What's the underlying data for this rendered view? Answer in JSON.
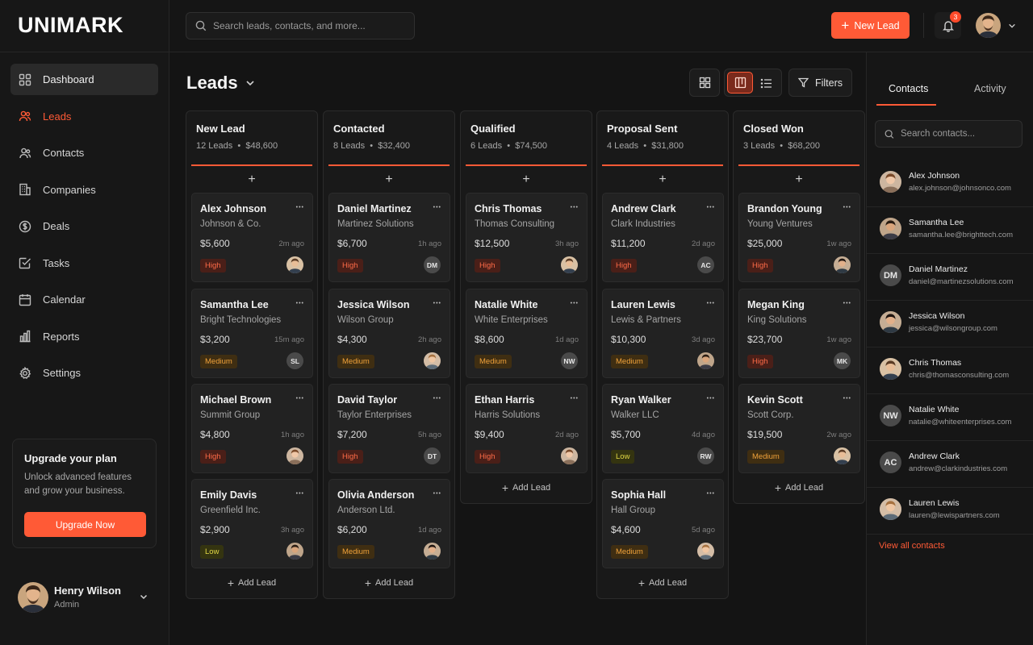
{
  "app": {
    "logo": "UNIMARK"
  },
  "topbar": {
    "search_placeholder": "Search leads, contacts, and more...",
    "new_lead_label": "New Lead",
    "notification_count": "3"
  },
  "sidebar": {
    "items": [
      {
        "label": "Dashboard",
        "icon": "dashboard-icon"
      },
      {
        "label": "Leads",
        "icon": "users-icon"
      },
      {
        "label": "Contacts",
        "icon": "contacts-icon"
      },
      {
        "label": "Companies",
        "icon": "building-icon"
      },
      {
        "label": "Deals",
        "icon": "dollar-icon"
      },
      {
        "label": "Tasks",
        "icon": "task-check-icon"
      },
      {
        "label": "Calendar",
        "icon": "calendar-icon"
      },
      {
        "label": "Reports",
        "icon": "bar-chart-icon"
      },
      {
        "label": "Settings",
        "icon": "gear-icon"
      }
    ],
    "upgrade": {
      "title": "Upgrade your plan",
      "description": "Unlock advanced features and grow your business.",
      "button": "Upgrade Now"
    },
    "user": {
      "name": "Henry Wilson",
      "role": "Admin"
    }
  },
  "main": {
    "title": "Leads",
    "filters_label": "Filters",
    "add_lead_label": "Add Lead",
    "columns": [
      {
        "title": "New Lead",
        "count": "12 Leads",
        "total": "$48,600",
        "cards": [
          {
            "name": "Alex Johnson",
            "company": "Johnson & Co.",
            "value": "$5,600",
            "time": "2m ago",
            "priority": "High",
            "avatar": "photo"
          },
          {
            "name": "Samantha Lee",
            "company": "Bright Technologies",
            "value": "$3,200",
            "time": "15m ago",
            "priority": "Medium",
            "avatar": "SL"
          },
          {
            "name": "Michael Brown",
            "company": "Summit Group",
            "value": "$4,800",
            "time": "1h ago",
            "priority": "High",
            "avatar": "photo"
          },
          {
            "name": "Emily Davis",
            "company": "Greenfield Inc.",
            "value": "$2,900",
            "time": "3h ago",
            "priority": "Low",
            "avatar": "photo"
          }
        ]
      },
      {
        "title": "Contacted",
        "count": "8 Leads",
        "total": "$32,400",
        "cards": [
          {
            "name": "Daniel Martinez",
            "company": "Martinez Solutions",
            "value": "$6,700",
            "time": "1h ago",
            "priority": "High",
            "avatar": "DM"
          },
          {
            "name": "Jessica Wilson",
            "company": "Wilson Group",
            "value": "$4,300",
            "time": "2h ago",
            "priority": "Medium",
            "avatar": "photo"
          },
          {
            "name": "David Taylor",
            "company": "Taylor Enterprises",
            "value": "$7,200",
            "time": "5h ago",
            "priority": "High",
            "avatar": "DT"
          },
          {
            "name": "Olivia Anderson",
            "company": "Anderson Ltd.",
            "value": "$6,200",
            "time": "1d ago",
            "priority": "Medium",
            "avatar": "photo"
          }
        ]
      },
      {
        "title": "Qualified",
        "count": "6 Leads",
        "total": "$74,500",
        "cards": [
          {
            "name": "Chris Thomas",
            "company": "Thomas Consulting",
            "value": "$12,500",
            "time": "3h ago",
            "priority": "High",
            "avatar": "photo"
          },
          {
            "name": "Natalie White",
            "company": "White Enterprises",
            "value": "$8,600",
            "time": "1d ago",
            "priority": "Medium",
            "avatar": "NW"
          },
          {
            "name": "Ethan Harris",
            "company": "Harris Solutions",
            "value": "$9,400",
            "time": "2d ago",
            "priority": "High",
            "avatar": "photo"
          }
        ]
      },
      {
        "title": "Proposal Sent",
        "count": "4 Leads",
        "total": "$31,800",
        "cards": [
          {
            "name": "Andrew Clark",
            "company": "Clark Industries",
            "value": "$11,200",
            "time": "2d ago",
            "priority": "High",
            "avatar": "AC"
          },
          {
            "name": "Lauren Lewis",
            "company": "Lewis & Partners",
            "value": "$10,300",
            "time": "3d ago",
            "priority": "Medium",
            "avatar": "photo"
          },
          {
            "name": "Ryan Walker",
            "company": "Walker LLC",
            "value": "$5,700",
            "time": "4d ago",
            "priority": "Low",
            "avatar": "RW"
          },
          {
            "name": "Sophia Hall",
            "company": "Hall Group",
            "value": "$4,600",
            "time": "5d ago",
            "priority": "Medium",
            "avatar": "photo"
          }
        ]
      },
      {
        "title": "Closed Won",
        "count": "3 Leads",
        "total": "$68,200",
        "cards": [
          {
            "name": "Brandon Young",
            "company": "Young Ventures",
            "value": "$25,000",
            "time": "1w ago",
            "priority": "High",
            "avatar": "photo"
          },
          {
            "name": "Megan King",
            "company": "King Solutions",
            "value": "$23,700",
            "time": "1w ago",
            "priority": "High",
            "avatar": "MK"
          },
          {
            "name": "Kevin Scott",
            "company": "Scott Corp.",
            "value": "$19,500",
            "time": "2w ago",
            "priority": "Medium",
            "avatar": "photo"
          }
        ]
      }
    ]
  },
  "right_panel": {
    "tabs": [
      "Contacts",
      "Activity"
    ],
    "search_placeholder": "Search contacts...",
    "contacts": [
      {
        "name": "Alex Johnson",
        "email": "alex.johnson@johnsonco.com",
        "avatar": "photo"
      },
      {
        "name": "Samantha Lee",
        "email": "samantha.lee@brighttech.com",
        "avatar": "photo"
      },
      {
        "name": "Daniel Martinez",
        "email": "daniel@martinezsolutions.com",
        "avatar": "DM"
      },
      {
        "name": "Jessica Wilson",
        "email": "jessica@wilsongroup.com",
        "avatar": "photo"
      },
      {
        "name": "Chris Thomas",
        "email": "chris@thomasconsulting.com",
        "avatar": "photo"
      },
      {
        "name": "Natalie White",
        "email": "natalie@whiteenterprises.com",
        "avatar": "NW"
      },
      {
        "name": "Andrew Clark",
        "email": "andrew@clarkindustries.com",
        "avatar": "AC"
      },
      {
        "name": "Lauren Lewis",
        "email": "lauren@lewispartners.com",
        "avatar": "photo"
      }
    ],
    "view_all": "View all contacts"
  },
  "colors": {
    "accent": "#ff5a36",
    "high": "#ff6b48",
    "medium": "#f0a23a",
    "low": "#e1d845"
  }
}
